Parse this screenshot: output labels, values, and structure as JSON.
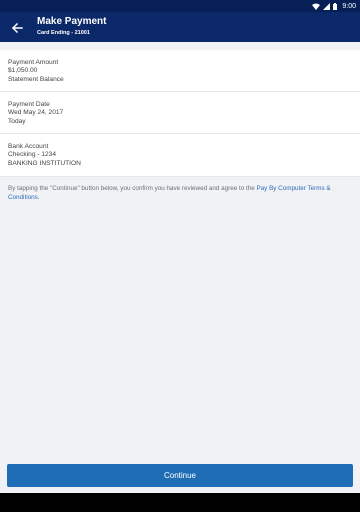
{
  "status_bar": {
    "time": "9:00",
    "icons": [
      "wifi-icon",
      "signal-icon",
      "battery-icon"
    ]
  },
  "app_bar": {
    "title": "Make Payment",
    "subtitle": "Card Ending - 21001",
    "back_icon": "arrow-left-icon"
  },
  "sections": {
    "amount": {
      "label": "Payment Amount",
      "value": "$1,050.00",
      "detail": "Statement Balance"
    },
    "date": {
      "label": "Payment Date",
      "value": "Wed May 24, 2017",
      "detail": "Today"
    },
    "account": {
      "label": "Bank Account",
      "value": "Checking - 1234",
      "detail": "BANKING INSTITUTION"
    }
  },
  "disclaimer": {
    "text": "By tapping the \"Continue\" button below, you confirm you have reviewed and agree to the",
    "link": "Pay By Computer Terms & Conditions",
    "end": "."
  },
  "actions": {
    "continue_label": "Continue"
  },
  "colors": {
    "app_bar": "#0b2968",
    "status_bar": "#071f57",
    "button": "#1f6db5",
    "link": "#2c6bb6",
    "background": "#f1f2f6"
  }
}
